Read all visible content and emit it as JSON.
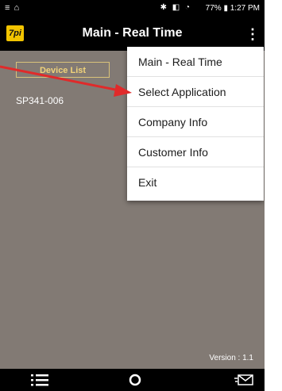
{
  "status": {
    "left": "≡ ⌂",
    "icons": "✱ ◧ ◔",
    "battery_time": "77% ▮ 1:27 PM"
  },
  "app": {
    "logo": "7pi",
    "title": "Main - Real Time"
  },
  "tabs": {
    "device_list": "Device List"
  },
  "devices": [
    "SP341-006"
  ],
  "version": "Version : 1.1",
  "menu": {
    "items": [
      "Main - Real Time",
      "Select Application",
      "Company Info",
      "Customer Info",
      "Exit"
    ]
  },
  "annotation": {
    "arrow_color": "#e02a2a"
  },
  "icons": {
    "overflow": "more-vert-icon",
    "list": "list-icon",
    "refresh": "refresh-icon",
    "mail": "mail-icon"
  }
}
